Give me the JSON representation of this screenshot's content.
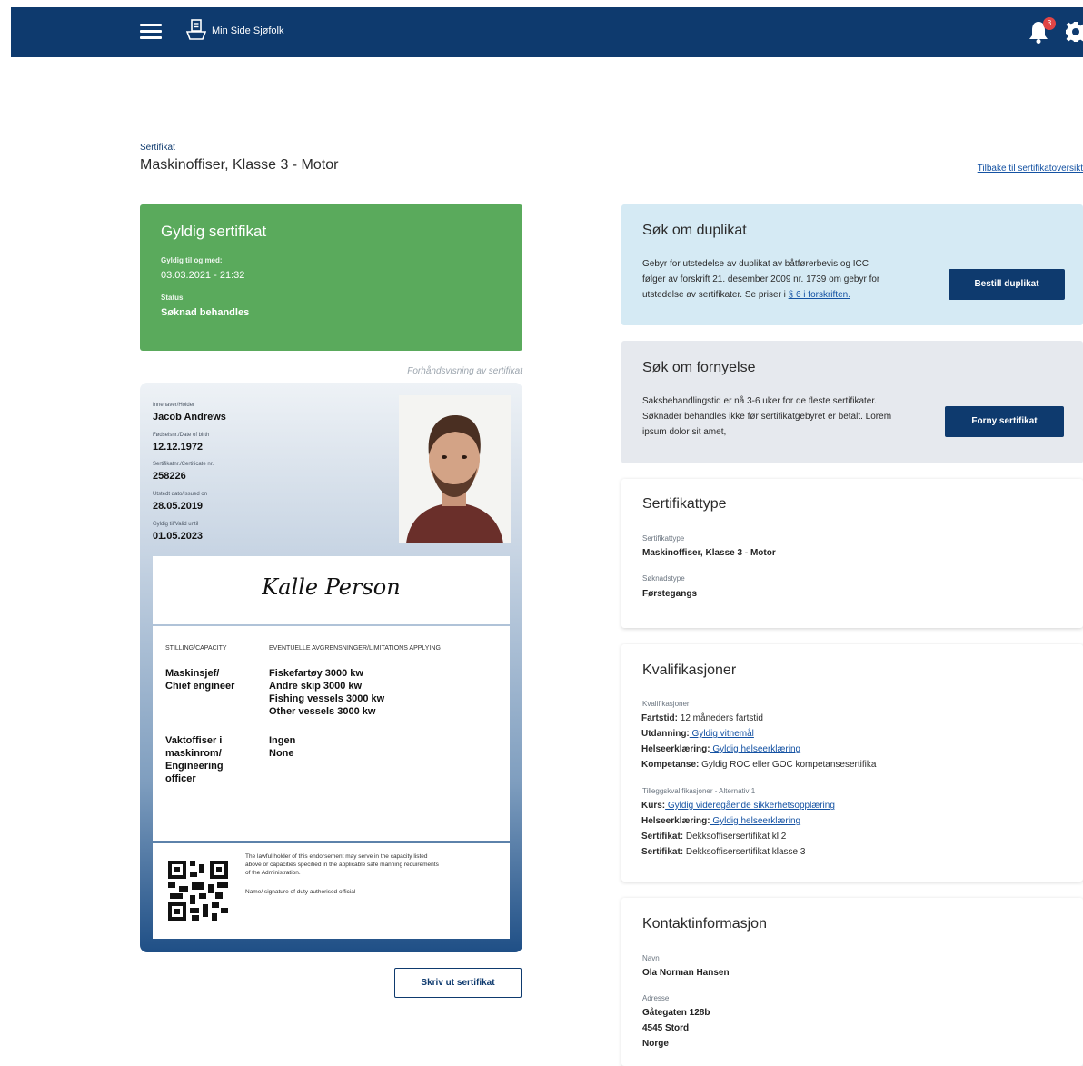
{
  "header": {
    "app_name": "Min Side Sjøfolk",
    "notification_count": "3",
    "bar_color": "#0e3a6e"
  },
  "breadcrumb": "Sertifikat",
  "page_title": "Maskinoffiser, Klasse 3 - Motor",
  "back_link": "Tilbake til sertifikatoversikt",
  "status_card": {
    "title": "Gyldig sertifikat",
    "valid_label": "Gyldig til og med:",
    "valid_value": "03.03.2021 - 21:32",
    "status_label": "Status",
    "status_value": "Søknad behandles",
    "color": "#5aaa5c"
  },
  "preview_label": "Forhåndsvisning av sertifikat",
  "certificate": {
    "holder_label": "Innehaver/Holder",
    "holder_value": "Jacob Andrews",
    "dob_label": "Fødselsnr./Date of birth",
    "dob_value": "12.12.1972",
    "certno_label": "Sertifikatnr./Certificate nr.",
    "certno_value": "258226",
    "issued_label": "Utstedt dato/Issued on",
    "issued_value": "28.05.2019",
    "valid_label": "Gyldig til/Valid until",
    "valid_value": "01.05.2023",
    "signature": "Kalle Person",
    "capacity_header": "STILLING/CAPACITY",
    "limitations_header": "EVENTUELLE AVGRENSNINGER/LIMITATIONS APPLYING",
    "rows": [
      {
        "capacity": "Maskinsjef/\nChief engineer",
        "limitations": "Fiskefartøy 3000 kw\nAndre skip 3000 kw\nFishing vessels 3000 kw\nOther vessels 3000 kw"
      },
      {
        "capacity": "Vaktoffiser i\nmaskinrom/\nEngineering\nofficer",
        "limitations": "Ingen\nNone"
      }
    ],
    "footer_text": "The lawful holder of this endorsement may serve in the capacity listed above or capacities specified in the applicable safe manning requirements of the Administration.",
    "footer_signature": "Name/ signature of duty authorised official"
  },
  "print_button": "Skriv ut sertifikat",
  "duplicate": {
    "title": "Søk om duplikat",
    "text": "Gebyr for utstedelse av duplikat av båtførerbevis og ICC følger av forskrift 21. desember 2009 nr. 1739 om gebyr for utstedelse av sertifikater. Se priser i ",
    "link": "§ 6 i forskriften.",
    "button": "Bestill duplikat"
  },
  "renewal": {
    "title": "Søk om fornyelse",
    "text": "Saksbehandlingstid er nå 3-6 uker for de fleste sertifikater. Søknader behandles ikke før sertifikatgebyret er betalt. Lorem ipsum dolor sit amet,",
    "button": "Forny sertifikat"
  },
  "cert_type": {
    "title": "Sertifikattype",
    "type_label": "Sertifikattype",
    "type_value": "Maskinoffiser, Klasse 3 - Motor",
    "app_label": "Søknadstype",
    "app_value": "Førstegangs"
  },
  "qualifications": {
    "title": "Kvalifikasjoner",
    "section1_label": "Kvalifikasjoner",
    "items1": [
      {
        "key": "Fartstid:",
        "value": " 12 måneders fartstid",
        "link": false
      },
      {
        "key": "Utdanning:",
        "value": " Gyldig vitnemål",
        "link": true
      },
      {
        "key": "Helseerklæring:",
        "value": " Gyldig helseerklæring",
        "link": true
      },
      {
        "key": "Kompetanse:",
        "value": " Gyldig ROC eller GOC kompetansesertifika",
        "link": false
      }
    ],
    "section2_label": "Tilleggskvalifikasjoner - Alternativ 1",
    "items2": [
      {
        "key": "Kurs:",
        "value": " Gyldig videregående sikkerhetsopplæring",
        "link": true
      },
      {
        "key": "Helseerklæring:",
        "value": " Gyldig helseerklæring",
        "link": true
      },
      {
        "key": "Sertifikat:",
        "value": " Dekksoffisersertifikat kl 2",
        "link": false
      },
      {
        "key": "Sertifikat:",
        "value": " Dekksoffisersertifikat klasse 3",
        "link": false
      }
    ]
  },
  "contact": {
    "title": "Kontaktinformasjon",
    "name_label": "Navn",
    "name_value": "Ola Norman Hansen",
    "address_label": "Adresse",
    "address_line1": "Gåtegaten 128b",
    "address_line2": "4545 Stord",
    "address_line3": "Norge"
  }
}
